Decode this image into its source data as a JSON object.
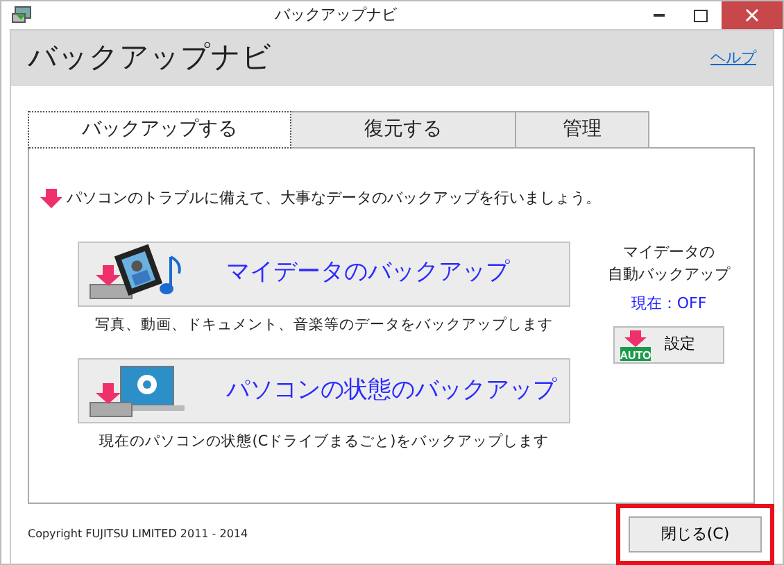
{
  "window": {
    "title": "バックアップナビ"
  },
  "header": {
    "title": "バックアップナビ",
    "help_link": "ヘルプ"
  },
  "tabs": [
    {
      "label": "バックアップする",
      "selected": true
    },
    {
      "label": "復元する",
      "selected": false
    },
    {
      "label": "管理",
      "selected": false
    }
  ],
  "intro": "パソコンのトラブルに備えて、大事なデータのバックアップを行いましょう。",
  "actions": [
    {
      "kind": "mydata",
      "label": "マイデータのバックアップ",
      "caption": "写真、動画、ドキュメント、音楽等のデータをバックアップします"
    },
    {
      "kind": "system",
      "label": "パソコンの状態のバックアップ",
      "caption": "現在のパソコンの状態(Cドライブまるごと)をバックアップします"
    }
  ],
  "auto_backup": {
    "title_lines": [
      "マイデータの",
      "自動バックアップ"
    ],
    "status": "現在：OFF",
    "settings_button": "設定",
    "icon_badge": "AUTO"
  },
  "footer": {
    "copyright": "Copyright FUJITSU LIMITED 2011 - 2014",
    "close_button": "閉じる(C)",
    "close_highlighted": true
  }
}
